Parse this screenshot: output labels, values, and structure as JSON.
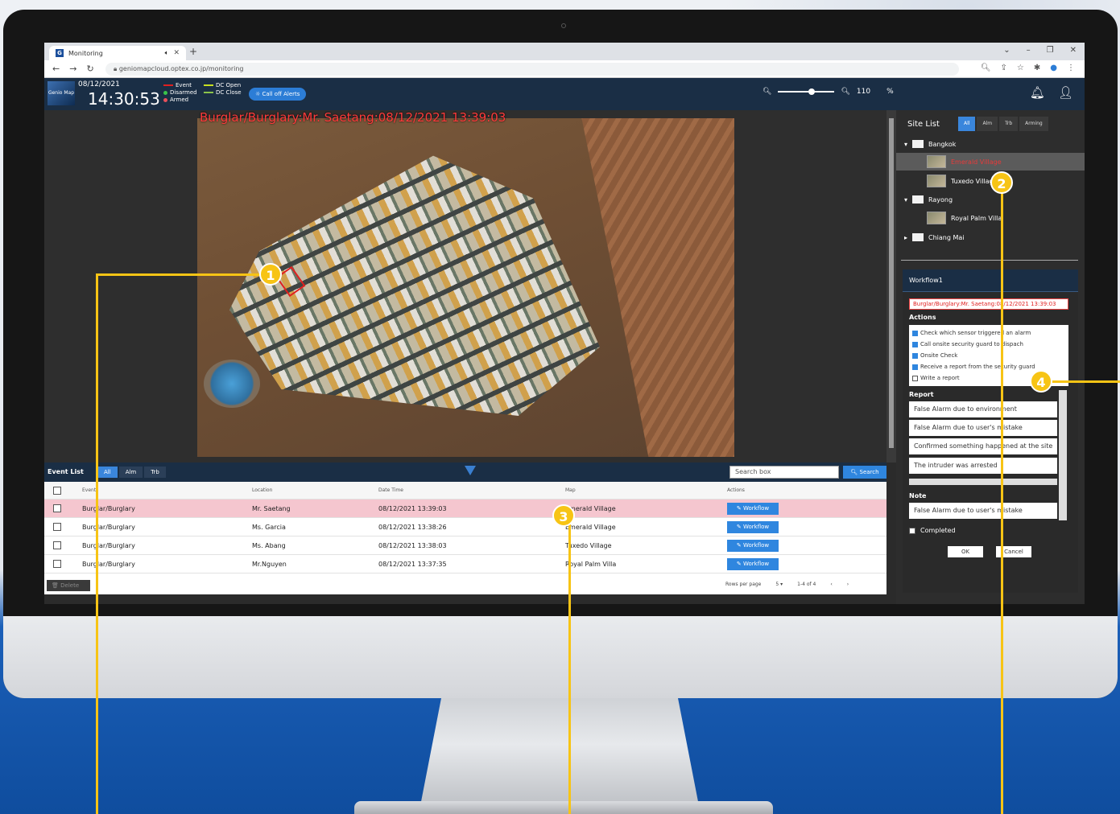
{
  "browser": {
    "tab_title": "Monitoring",
    "url": "geniomapcloud.optex.co.jp/monitoring"
  },
  "header": {
    "logo_text": "Genio Map",
    "date": "08/12/2021",
    "time": "14:30:53",
    "legend": {
      "event": "Event",
      "disarmed": "Disarmed",
      "armed": "Armed",
      "dc_open": "DC Open",
      "dc_close": "DC Close"
    },
    "call_off_label": "Call off Alerts",
    "zoom_value": "110",
    "zoom_unit": "%",
    "colors": {
      "event": "#e02020",
      "disarmed": "#3ac34a",
      "armed": "#e8505b",
      "dc_open": "#c7e021",
      "dc_close": "#8bc34a"
    }
  },
  "map": {
    "alarm_title": "Burglar/Burglary:Mr. Saetang:08/12/2021 13:39:03"
  },
  "event_list": {
    "title": "Event List",
    "tabs": [
      "All",
      "Alm",
      "Trb"
    ],
    "search_placeholder": "Search box",
    "search_label": "Search",
    "columns": [
      "Event",
      "Location",
      "Date Time",
      "Map",
      "Actions"
    ],
    "rows": [
      {
        "event": "Burglar/Burglary",
        "location": "Mr. Saetang",
        "datetime": "08/12/2021 13:39:03",
        "map": "Emerald Village",
        "action": "Workflow"
      },
      {
        "event": "Burglar/Burglary",
        "location": "Ms. Garcia",
        "datetime": "08/12/2021 13:38:26",
        "map": "Emerald Village",
        "action": "Workflow"
      },
      {
        "event": "Burglar/Burglary",
        "location": "Ms. Abang",
        "datetime": "08/12/2021 13:38:03",
        "map": "Tuxedo Village",
        "action": "Workflow"
      },
      {
        "event": "Burglar/Burglary",
        "location": "Mr.Nguyen",
        "datetime": "08/12/2021 13:37:35",
        "map": "Royal Palm Villa",
        "action": "Workflow"
      }
    ],
    "delete_label": "Delete",
    "rows_per_page_label": "Rows per page",
    "rows_per_page_value": "5",
    "range": "1-4 of 4"
  },
  "site_list": {
    "title": "Site List",
    "tabs": [
      "All",
      "Alm",
      "Trb",
      "Arming"
    ],
    "tree": {
      "bangkok": "Bangkok",
      "emerald": "Emerald Village",
      "tuxedo": "Tuxedo Village",
      "rayong": "Rayong",
      "royal": "Royal Palm Villa",
      "chiangmai": "Chiang Mai"
    }
  },
  "workflow": {
    "title": "Workflow1",
    "alert": "Burglar/Burglary:Mr. Saetang:08/12/2021 13:39:03",
    "actions_label": "Actions",
    "actions": [
      {
        "text": "Check which sensor triggered an alarm",
        "checked": true
      },
      {
        "text": "Call onsite security guard to dispach",
        "checked": true
      },
      {
        "text": "Onsite Check",
        "checked": true
      },
      {
        "text": "Receive a report from the security guard",
        "checked": true
      },
      {
        "text": "Write a report",
        "checked": false
      }
    ],
    "report_label": "Report",
    "reports": [
      "False Alarm due to environment",
      "False Alarm due to user's mistake",
      "Confirmed something happened at the site",
      "The intruder was arrested"
    ],
    "note_label": "Note",
    "note": "False Alarm due to user's mistake",
    "completed_label": "Completed",
    "ok_label": "OK",
    "cancel_label": "Cancel"
  },
  "callouts": [
    "1",
    "2",
    "3",
    "4"
  ]
}
